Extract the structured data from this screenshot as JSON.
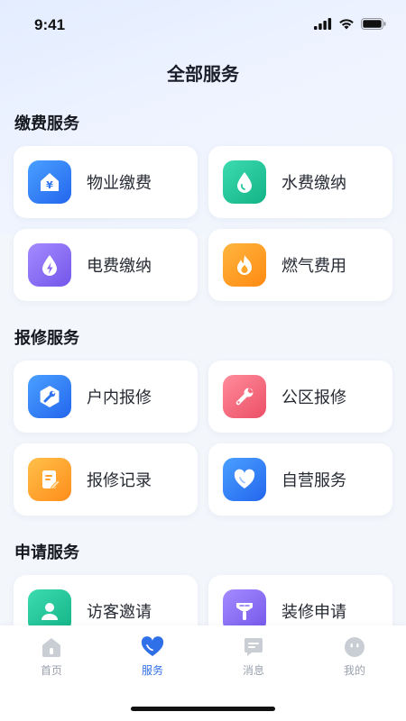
{
  "status": {
    "time": "9:41"
  },
  "page": {
    "title": "全部服务"
  },
  "sections": [
    {
      "title": "缴费服务"
    },
    {
      "title": "报修服务"
    },
    {
      "title": "申请服务"
    }
  ],
  "cards": [
    {
      "label": "物业缴费",
      "icon": "house-yuan-icon",
      "color": "#2d7cf6"
    },
    {
      "label": "水费缴纳",
      "icon": "water-drop-icon",
      "color": "#1fc49a"
    },
    {
      "label": "电费缴纳",
      "icon": "lightning-drop-icon",
      "color": "#8a6cf2"
    },
    {
      "label": "燃气费用",
      "icon": "flame-icon",
      "color": "#ff9a1e"
    },
    {
      "label": "户内报修",
      "icon": "wrench-hexagon-icon",
      "color": "#2d7cf6"
    },
    {
      "label": "公区报修",
      "icon": "wrench-icon",
      "color": "#f46a7d"
    },
    {
      "label": "报修记录",
      "icon": "note-pencil-icon",
      "color": "#ff9f2a"
    },
    {
      "label": "自营服务",
      "icon": "heart-icon",
      "color": "#2d7cf6"
    },
    {
      "label": "访客邀请",
      "icon": "person-icon",
      "color": "#1fc49a"
    },
    {
      "label": "装修申请",
      "icon": "brush-icon",
      "color": "#8a6cf2"
    }
  ],
  "tabs": [
    {
      "label": "首页",
      "icon": "home-icon"
    },
    {
      "label": "服务",
      "icon": "heart-icon",
      "active": true
    },
    {
      "label": "消息",
      "icon": "message-icon"
    },
    {
      "label": "我的",
      "icon": "smile-face-icon"
    }
  ]
}
